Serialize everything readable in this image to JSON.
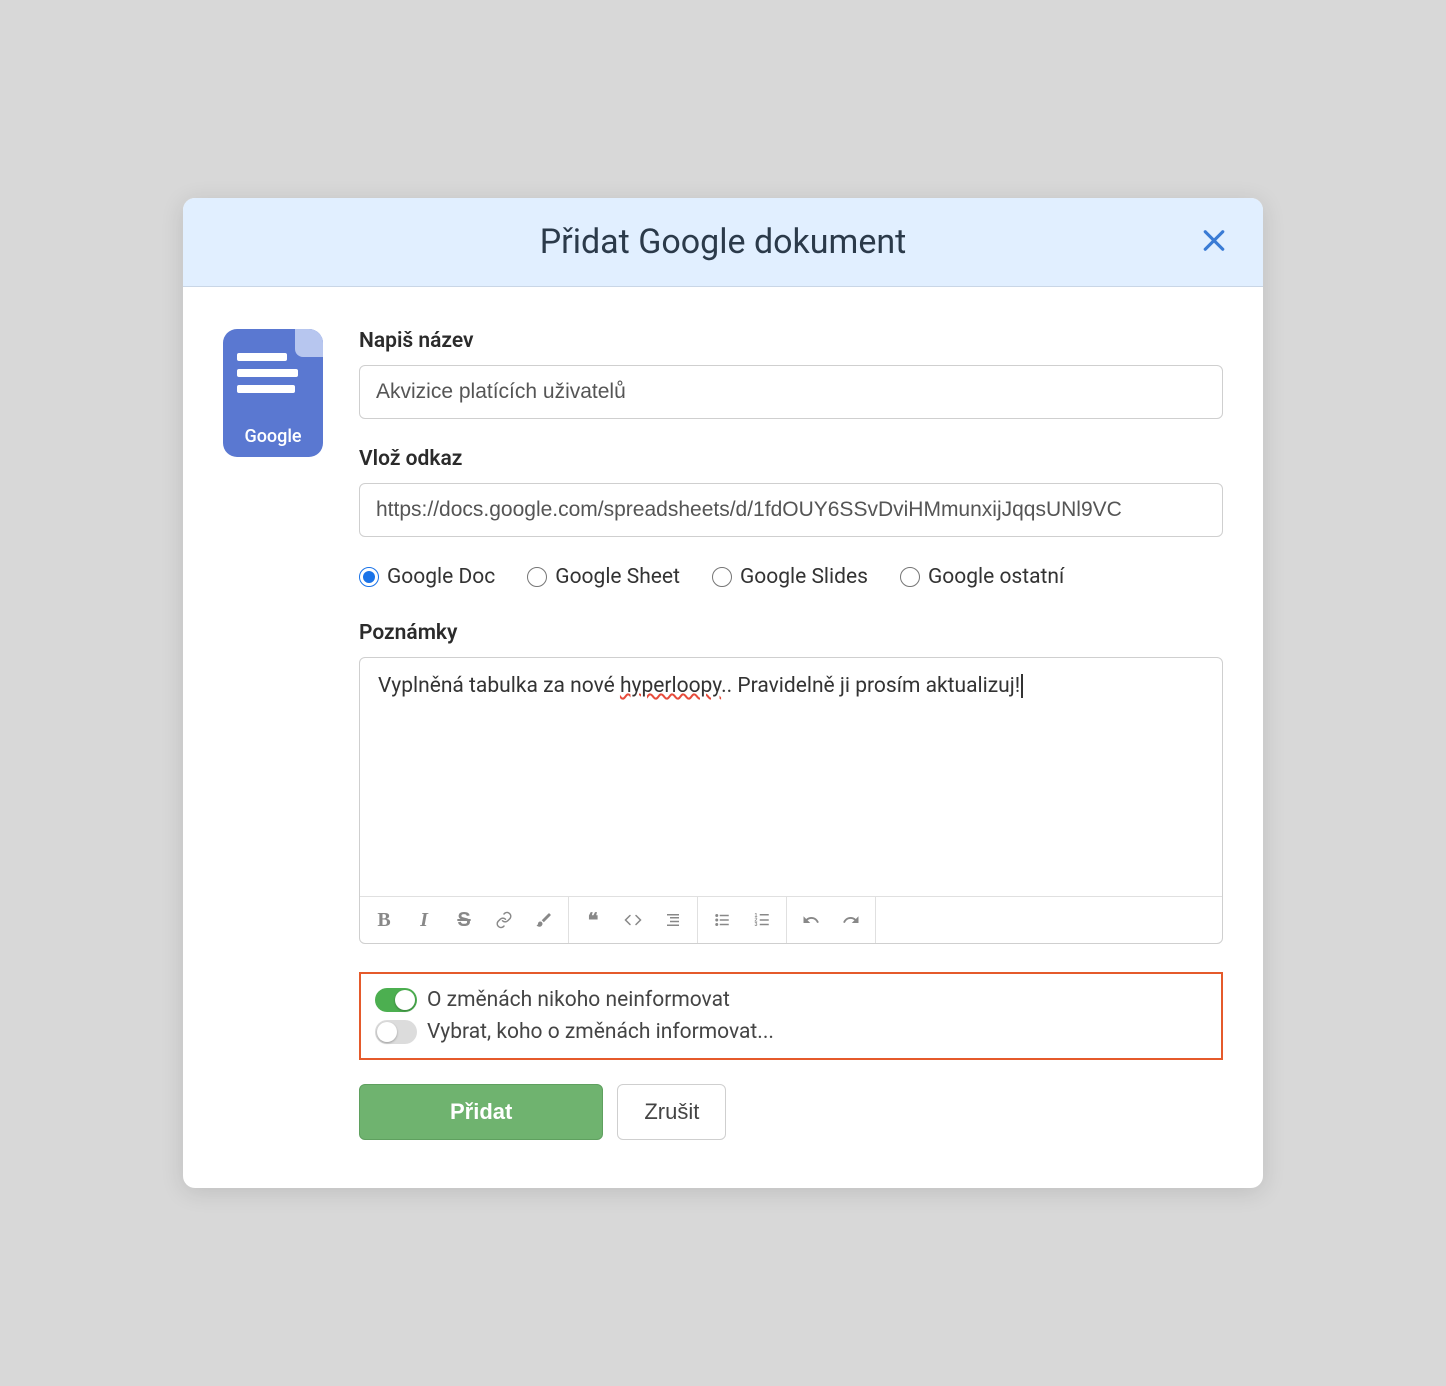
{
  "modal": {
    "title": "Přidat Google dokument",
    "doc_icon_label": "Google"
  },
  "form": {
    "title_label": "Napiš název",
    "title_value": "Akvizice platících uživatelů",
    "link_label": "Vlož odkaz",
    "link_value": "https://docs.google.com/spreadsheets/d/1fdOUY6SSvDviHMmunxijJqqsUNl9VC",
    "notes_label": "Poznámky",
    "notes_value_pre": "Vyplněná tabulka za nové ",
    "notes_value_err": "hyperloopy",
    "notes_value_post": ".. Pravidelně ji prosím aktualizuj!"
  },
  "radios": [
    {
      "label": "Google Doc",
      "checked": true
    },
    {
      "label": "Google Sheet",
      "checked": false
    },
    {
      "label": "Google Slides",
      "checked": false
    },
    {
      "label": "Google ostatní",
      "checked": false
    }
  ],
  "toolbar": {
    "bold": "B",
    "italic": "I",
    "strike": "S",
    "quote": "❝",
    "code": "</>"
  },
  "switches": {
    "no_inform": {
      "label": "O změnách nikoho neinformovat",
      "on": true
    },
    "select_inform": {
      "label": "Vybrat, koho o změnách informovat...",
      "on": false
    }
  },
  "buttons": {
    "submit": "Přidat",
    "cancel": "Zrušit"
  }
}
